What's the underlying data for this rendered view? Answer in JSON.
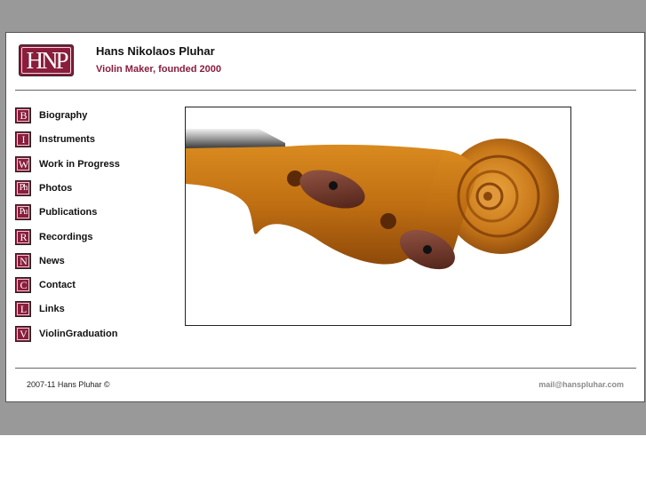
{
  "header": {
    "logo_text": "HNP",
    "title": "Hans Nikolaos Pluhar",
    "subtitle": "Violin Maker, founded 2000"
  },
  "nav": [
    {
      "icon": "B",
      "label": "Biography"
    },
    {
      "icon": "I",
      "label": "Instruments"
    },
    {
      "icon": "W",
      "label": "Work in Progress"
    },
    {
      "icon": "Ph",
      "label": "Photos"
    },
    {
      "icon": "Pu",
      "label": "Publications"
    },
    {
      "icon": "R",
      "label": "Recordings"
    },
    {
      "icon": "N",
      "label": "News"
    },
    {
      "icon": "C",
      "label": "Contact"
    },
    {
      "icon": "L",
      "label": "Links"
    },
    {
      "icon": "V",
      "label": "ViolinGraduation"
    }
  ],
  "footer": {
    "copyright": "2007-11  Hans Pluhar ©",
    "email": "mail@hanspluhar.com"
  },
  "colors": {
    "brand": "#8a1d3c",
    "page_band": "#999999"
  }
}
